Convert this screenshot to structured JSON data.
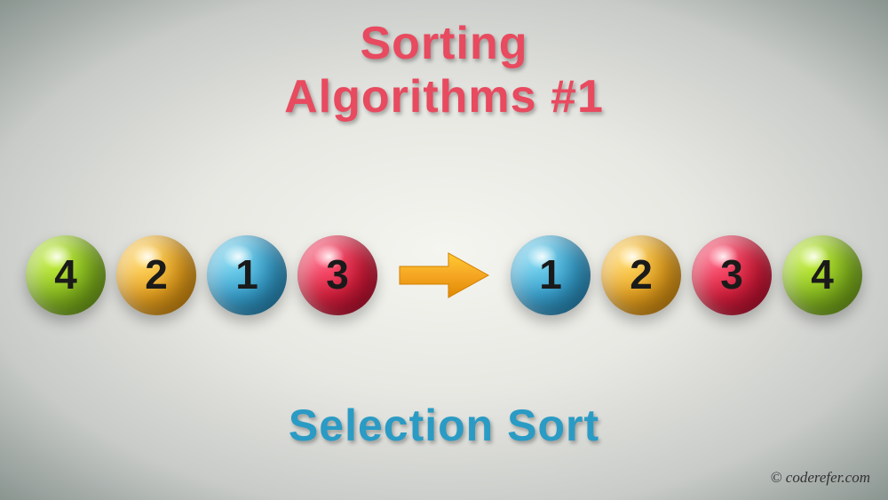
{
  "title_line1": "Sorting",
  "title_line2": "Algorithms #1",
  "subtitle": "Selection Sort",
  "credit": "© coderefer.com",
  "colors": {
    "green": "#8dc220",
    "yellow": "#f0a820",
    "blue": "#3aa8d8",
    "red": "#e0203f",
    "title_color": "#e84a5f",
    "subtitle_color": "#2a9bc4",
    "arrow": "#f5a623"
  },
  "left_sequence": [
    {
      "value": "4",
      "color": "green"
    },
    {
      "value": "2",
      "color": "yellow"
    },
    {
      "value": "1",
      "color": "blue"
    },
    {
      "value": "3",
      "color": "red"
    }
  ],
  "right_sequence": [
    {
      "value": "1",
      "color": "blue"
    },
    {
      "value": "2",
      "color": "yellow"
    },
    {
      "value": "3",
      "color": "red"
    },
    {
      "value": "4",
      "color": "green"
    }
  ]
}
